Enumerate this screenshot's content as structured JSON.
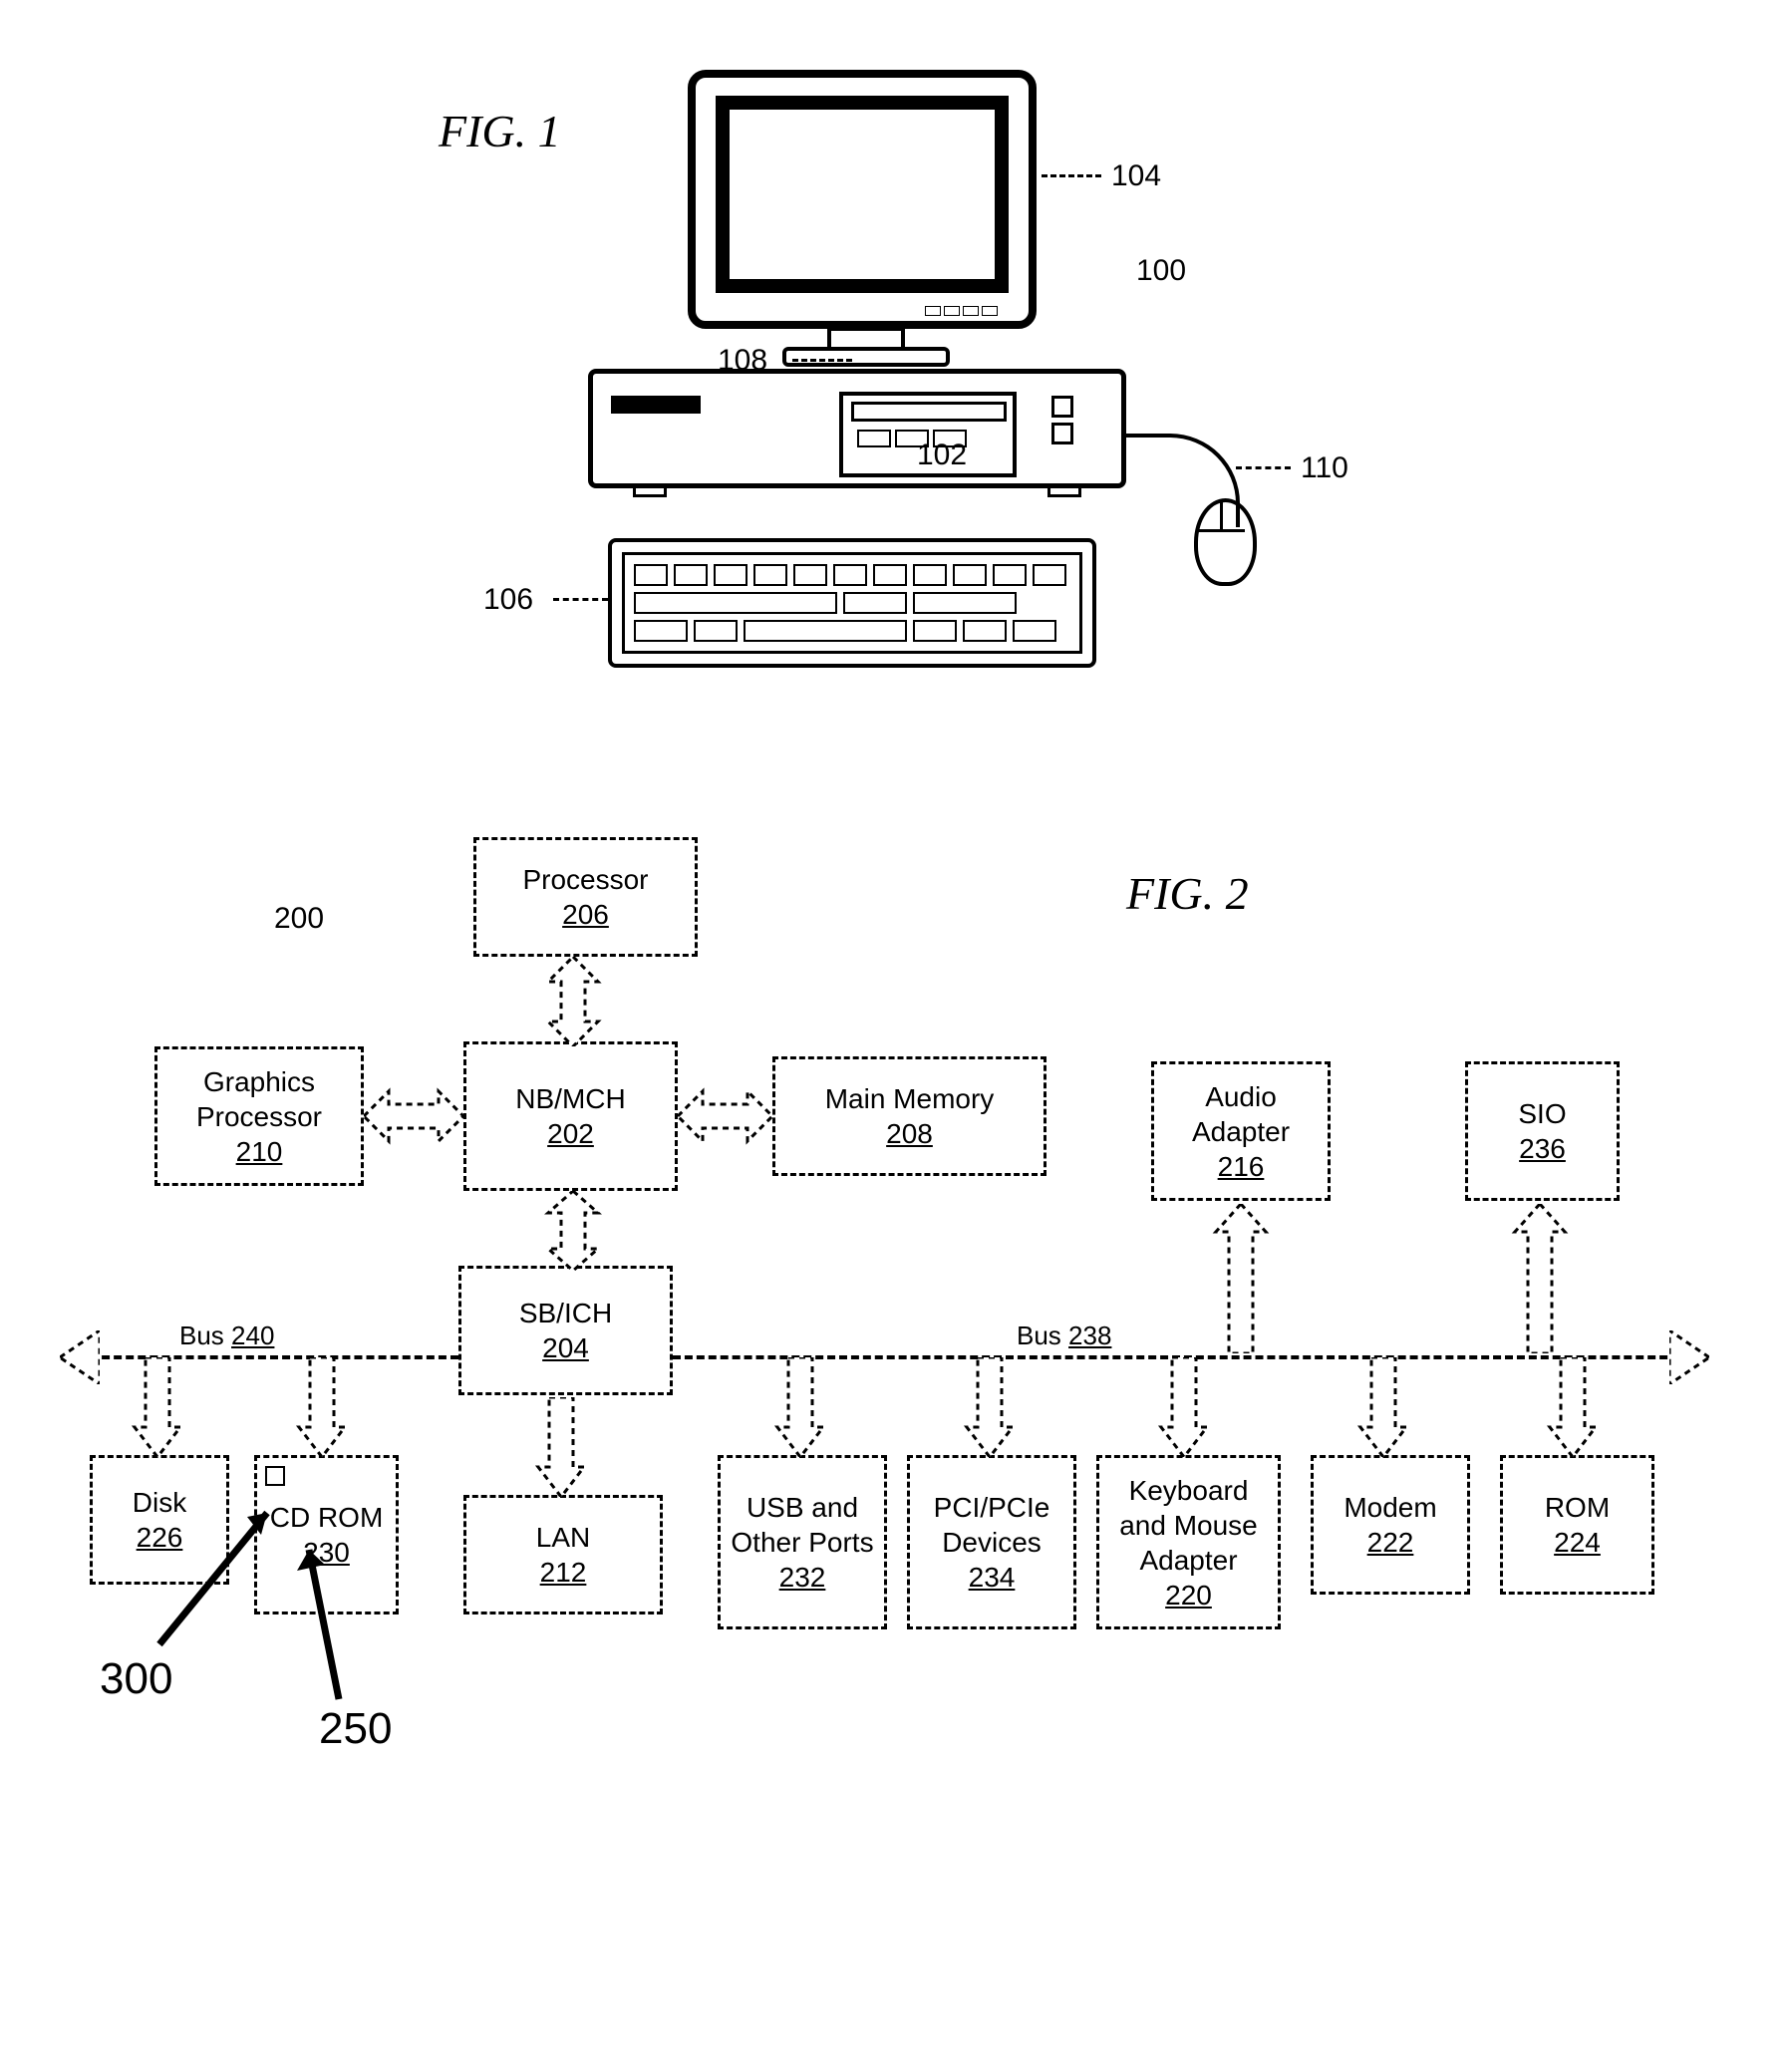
{
  "figures": {
    "fig1": {
      "label": "FIG. 1"
    },
    "fig2": {
      "label": "FIG. 2"
    }
  },
  "fig1_refs": {
    "system": "100",
    "case": "102",
    "monitor": "104",
    "keyboard": "106",
    "drive": "108",
    "mouse": "110"
  },
  "fig2": {
    "system_ref": "200",
    "blocks": {
      "processor": {
        "label": "Processor",
        "num": "206"
      },
      "gfx": {
        "label": "Graphics Processor",
        "num": "210"
      },
      "nbmch": {
        "label": "NB/MCH",
        "num": "202"
      },
      "mainmem": {
        "label": "Main Memory",
        "num": "208"
      },
      "sbich": {
        "label": "SB/ICH",
        "num": "204"
      },
      "audio": {
        "label": "Audio Adapter",
        "num": "216"
      },
      "sio": {
        "label": "SIO",
        "num": "236"
      },
      "disk": {
        "label": "Disk",
        "num": "226"
      },
      "cdrom": {
        "label": "CD ROM",
        "num": "230"
      },
      "lan": {
        "label": "LAN",
        "num": "212"
      },
      "usb": {
        "label": "USB and Other Ports",
        "num": "232"
      },
      "pci": {
        "label": "PCI/PCIe Devices",
        "num": "234"
      },
      "kbm": {
        "label": "Keyboard and Mouse Adapter",
        "num": "220"
      },
      "modem": {
        "label": "Modem",
        "num": "222"
      },
      "rom": {
        "label": "ROM",
        "num": "224"
      }
    },
    "bus_left": {
      "label": "Bus",
      "num": "240"
    },
    "bus_right": {
      "label": "Bus",
      "num": "238"
    },
    "callouts": {
      "c300": "300",
      "c250": "250"
    }
  }
}
